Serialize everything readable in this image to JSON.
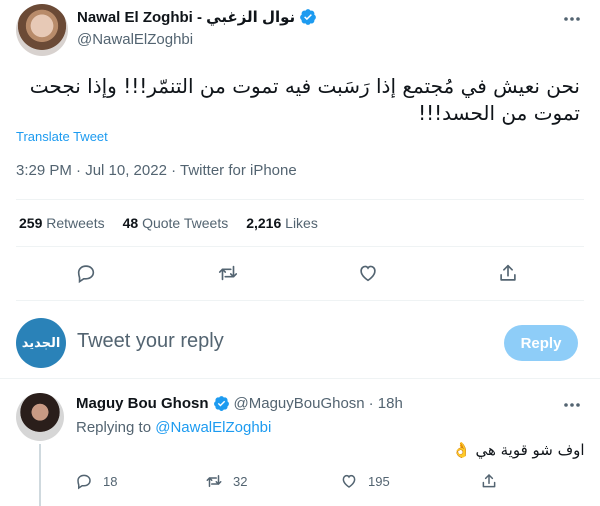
{
  "main_tweet": {
    "display_name": "Nawal El Zoghbi - نوال الزغبي",
    "handle": "@NawalElZoghbi",
    "text": "نحن نعيش في مُجتمع إذا رَسَبت فيه تموت من التنمّر!!! وإذا نجحت تموت  من الحسد!!!",
    "translate_label": "Translate Tweet",
    "timestamp": "3:29 PM · Jul 10, 2022 · Twitter for iPhone",
    "stats": {
      "retweets_count": "259",
      "retweets_label": "Retweets",
      "quotes_count": "48",
      "quotes_label": "Quote Tweets",
      "likes_count": "2,216",
      "likes_label": "Likes"
    },
    "actions": [
      "reply-icon",
      "retweet-icon",
      "like-icon",
      "share-icon"
    ]
  },
  "reply_box": {
    "avatar_text": "الجديد",
    "placeholder": "Tweet your reply",
    "button_label": "Reply"
  },
  "reply_tweet": {
    "display_name": "Maguy Bou Ghosn",
    "handle": "@MaguyBouGhosn",
    "time": "· 18h",
    "replying_prefix": "Replying to",
    "replying_to": "@NawalElZoghbi",
    "text": "اوف شو قوية هي 👌",
    "counts": {
      "replies": "18",
      "retweets": "32",
      "likes": "195"
    }
  },
  "colors": {
    "accent": "#1d9bf0",
    "reply_button": "#8ecdf8",
    "muted_text": "#536471"
  }
}
